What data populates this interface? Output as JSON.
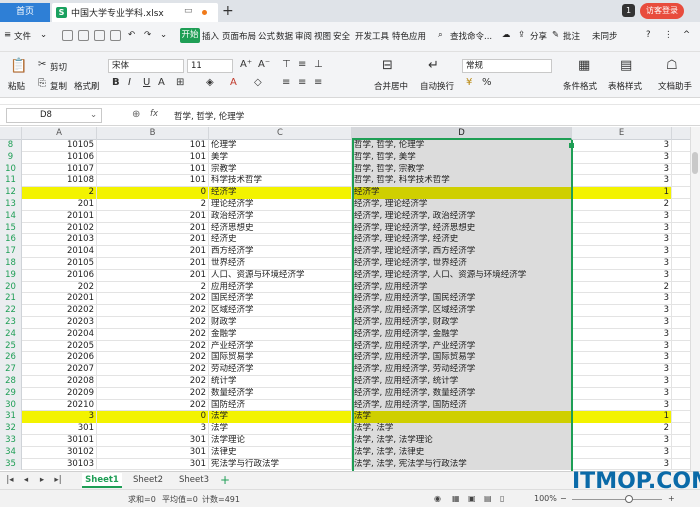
{
  "tabs": {
    "home": "首页",
    "file": "中国大学专业学科.xlsx",
    "plus": "+",
    "visitor": "访客登录",
    "badge": "1"
  },
  "menu": {
    "file": "文件",
    "start": "开始",
    "items": [
      "插入",
      "页面布局",
      "公式",
      "数据",
      "审阅",
      "视图",
      "安全",
      "开发工具",
      "特色应用"
    ],
    "search": "查找命令...",
    "share": "分享",
    "comment": "批注",
    "sync": "未同步"
  },
  "ribbon": {
    "paste": "粘贴",
    "cut": "剪切",
    "copy": "复制",
    "format_painter": "格式刷",
    "font": "宋体",
    "font_size": "11",
    "merge": "合并居中",
    "wrap": "自动换行",
    "number_format": "常规",
    "cond_format": "条件格式",
    "table_style": "表格样式",
    "doc_assist": "文档助手"
  },
  "formula_bar": {
    "cell_ref": "D8",
    "fx": "fx",
    "value": "哲学, 哲学, 伦理学"
  },
  "columns": [
    "A",
    "B",
    "C",
    "D",
    "E"
  ],
  "rows": [
    {
      "n": "8",
      "a": "10105",
      "b": "101",
      "c": "伦理学",
      "d": "哲学, 哲学, 伦理学",
      "e": "3"
    },
    {
      "n": "9",
      "a": "10106",
      "b": "101",
      "c": "美学",
      "d": "哲学, 哲学, 美学",
      "e": "3"
    },
    {
      "n": "10",
      "a": "10107",
      "b": "101",
      "c": "宗教学",
      "d": "哲学, 哲学, 宗教学",
      "e": "3"
    },
    {
      "n": "11",
      "a": "10108",
      "b": "101",
      "c": "科学技术哲学",
      "d": "哲学, 哲学, 科学技术哲学",
      "e": "3"
    },
    {
      "n": "12",
      "a": "2",
      "b": "0",
      "c": "经济学",
      "d": "经济学",
      "e": "1",
      "hl": true
    },
    {
      "n": "13",
      "a": "201",
      "b": "2",
      "c": "理论经济学",
      "d": "经济学, 理论经济学",
      "e": "2"
    },
    {
      "n": "14",
      "a": "20101",
      "b": "201",
      "c": "政治经济学",
      "d": "经济学, 理论经济学, 政治经济学",
      "e": "3"
    },
    {
      "n": "15",
      "a": "20102",
      "b": "201",
      "c": "经济思想史",
      "d": "经济学, 理论经济学, 经济思想史",
      "e": "3"
    },
    {
      "n": "16",
      "a": "20103",
      "b": "201",
      "c": "经济史",
      "d": "经济学, 理论经济学, 经济史",
      "e": "3"
    },
    {
      "n": "17",
      "a": "20104",
      "b": "201",
      "c": "西方经济学",
      "d": "经济学, 理论经济学, 西方经济学",
      "e": "3"
    },
    {
      "n": "18",
      "a": "20105",
      "b": "201",
      "c": "世界经济",
      "d": "经济学, 理论经济学, 世界经济",
      "e": "3"
    },
    {
      "n": "19",
      "a": "20106",
      "b": "201",
      "c": "人口、资源与环境经济学",
      "d": "经济学, 理论经济学, 人口、资源与环境经济学",
      "e": "3"
    },
    {
      "n": "20",
      "a": "202",
      "b": "2",
      "c": "应用经济学",
      "d": "经济学, 应用经济学",
      "e": "2"
    },
    {
      "n": "21",
      "a": "20201",
      "b": "202",
      "c": "国民经济学",
      "d": "经济学, 应用经济学, 国民经济学",
      "e": "3"
    },
    {
      "n": "22",
      "a": "20202",
      "b": "202",
      "c": "区域经济学",
      "d": "经济学, 应用经济学, 区域经济学",
      "e": "3"
    },
    {
      "n": "23",
      "a": "20203",
      "b": "202",
      "c": "财政学",
      "d": "经济学, 应用经济学, 财政学",
      "e": "3"
    },
    {
      "n": "24",
      "a": "20204",
      "b": "202",
      "c": "金融学",
      "d": "经济学, 应用经济学, 金融学",
      "e": "3"
    },
    {
      "n": "25",
      "a": "20205",
      "b": "202",
      "c": "产业经济学",
      "d": "经济学, 应用经济学, 产业经济学",
      "e": "3"
    },
    {
      "n": "26",
      "a": "20206",
      "b": "202",
      "c": "国际贸易学",
      "d": "经济学, 应用经济学, 国际贸易学",
      "e": "3"
    },
    {
      "n": "27",
      "a": "20207",
      "b": "202",
      "c": "劳动经济学",
      "d": "经济学, 应用经济学, 劳动经济学",
      "e": "3"
    },
    {
      "n": "28",
      "a": "20208",
      "b": "202",
      "c": "统计学",
      "d": "经济学, 应用经济学, 统计学",
      "e": "3"
    },
    {
      "n": "29",
      "a": "20209",
      "b": "202",
      "c": "数量经济学",
      "d": "经济学, 应用经济学, 数量经济学",
      "e": "3"
    },
    {
      "n": "30",
      "a": "20210",
      "b": "202",
      "c": "国防经济",
      "d": "经济学, 应用经济学, 国防经济",
      "e": "3"
    },
    {
      "n": "31",
      "a": "3",
      "b": "0",
      "c": "法学",
      "d": "法学",
      "e": "1",
      "hl": true
    },
    {
      "n": "32",
      "a": "301",
      "b": "3",
      "c": "法学",
      "d": "法学, 法学",
      "e": "2"
    },
    {
      "n": "33",
      "a": "30101",
      "b": "301",
      "c": "法学理论",
      "d": "法学, 法学, 法学理论",
      "e": "3"
    },
    {
      "n": "34",
      "a": "30102",
      "b": "301",
      "c": "法律史",
      "d": "法学, 法学, 法律史",
      "e": "3"
    },
    {
      "n": "35",
      "a": "30103",
      "b": "301",
      "c": "宪法学与行政法学",
      "d": "法学, 法学, 宪法学与行政法学",
      "e": "3"
    }
  ],
  "sheets": [
    "Sheet1",
    "Sheet2",
    "Sheet3"
  ],
  "status": {
    "sum": "求和=0",
    "avg": "平均值=0",
    "count": "计数=491",
    "zoom": "100%"
  },
  "watermark": "ITMOP.COM"
}
